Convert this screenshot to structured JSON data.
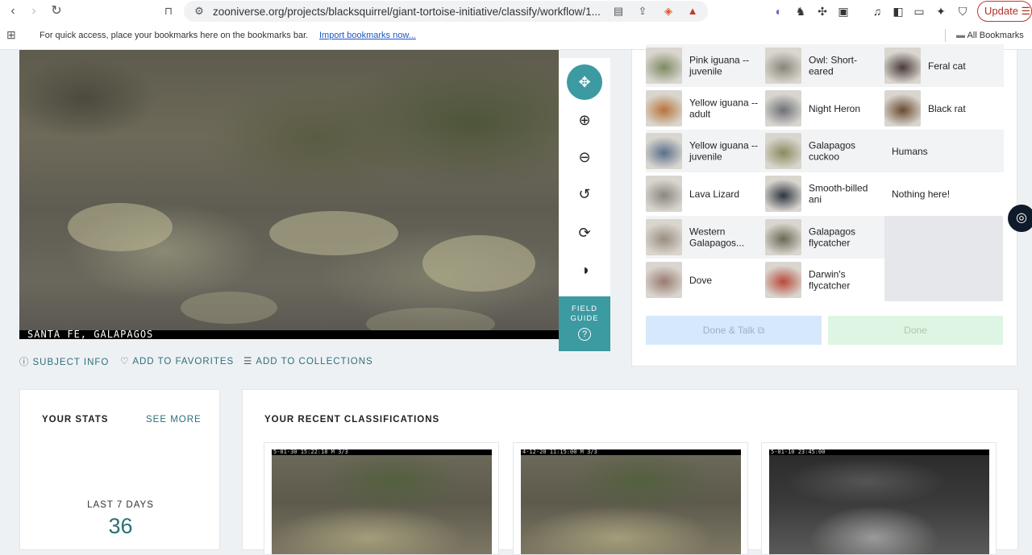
{
  "browser": {
    "url": "zooniverse.org/projects/blacksquirrel/giant-tortoise-initiative/classify/workflow/1...",
    "update_label": "Update",
    "bookmarks_message": "For quick access, place your bookmarks here on the bookmarks bar.",
    "import_link": "Import bookmarks now...",
    "all_bookmarks": "All Bookmarks",
    "brave_badge": "2"
  },
  "subject": {
    "caption": "SANTA FE, GALAPAGOS"
  },
  "toolbar": {
    "field_guide_label": "FIELD GUIDE",
    "field_guide_icon": "?"
  },
  "meta_links": {
    "subject_info": "SUBJECT INFO",
    "add_to_favorites": "ADD TO FAVORITES",
    "add_to_collections": "ADD TO COLLECTIONS"
  },
  "choices": [
    {
      "label": "Pink iguana -- juvenile",
      "color": "#7d8a62"
    },
    {
      "label": "Owl: Short-eared",
      "color": "#8a857a"
    },
    {
      "label": "Feral cat",
      "color": "#4a3a3a"
    },
    {
      "label": "Yellow iguana -- adult",
      "color": "#b8743a"
    },
    {
      "label": "Night Heron",
      "color": "#6e7078"
    },
    {
      "label": "Black rat",
      "color": "#6a4a30"
    },
    {
      "label": "Yellow iguana -- juvenile",
      "color": "#5a6f8a"
    },
    {
      "label": "Galapagos cuckoo",
      "color": "#8c8a5e"
    },
    {
      "label": "Humans",
      "color": ""
    },
    {
      "label": "Lava Lizard",
      "color": "#8a8680"
    },
    {
      "label": "Smooth-billed ani",
      "color": "#2e3440"
    },
    {
      "label": "Nothing here!",
      "color": ""
    },
    {
      "label": "Western Galapagos...",
      "color": "#9a8e80"
    },
    {
      "label": "Galapagos flycatcher",
      "color": "#6c6856"
    },
    {
      "label": "Dove",
      "color": "#9a7a70"
    },
    {
      "label": "Darwin's flycatcher",
      "color": "#b84a3a"
    }
  ],
  "actions": {
    "done_talk": "Done & Talk",
    "done": "Done"
  },
  "stats": {
    "title": "YOUR STATS",
    "see_more": "SEE MORE",
    "period": "LAST 7 DAYS",
    "count": "36"
  },
  "recent": {
    "title": "YOUR RECENT CLASSIFICATIONS",
    "items": [
      {
        "stamp": "5-01-30 15:22:18     M 3/3"
      },
      {
        "stamp": "4-12-20 11:15:00     M 3/3"
      },
      {
        "stamp": "5-01-10 23:45:00"
      }
    ]
  }
}
